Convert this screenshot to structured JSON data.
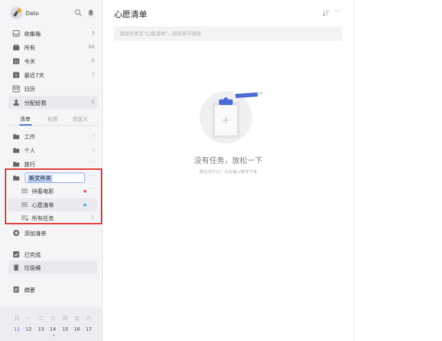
{
  "user": {
    "name": "Dato"
  },
  "nav": {
    "inbox": {
      "label": "收集箱",
      "count": "3"
    },
    "all": {
      "label": "所有",
      "count": "66"
    },
    "today": {
      "label": "今天",
      "count": "6",
      "icon_day": "11"
    },
    "next7": {
      "label": "最近7天",
      "count": "7",
      "icon_day": "5"
    },
    "calendar": {
      "label": "日历"
    },
    "assigned": {
      "label": "分配给我",
      "count": "5"
    }
  },
  "tabs": [
    "清单",
    "标签",
    "自定义"
  ],
  "folders": [
    {
      "label": "工作"
    },
    {
      "label": "个人"
    },
    {
      "label": "旅行"
    }
  ],
  "new_folder": {
    "value": "新文件夹",
    "more": "···"
  },
  "lists": [
    {
      "label": "待看电影",
      "dot_color": "#e8504a",
      "more": "···"
    },
    {
      "label": "心愿清单",
      "dot_color": "#3aa7e8"
    },
    {
      "label": "所有任务",
      "count": "1"
    }
  ],
  "add_list": {
    "label": "添加清单"
  },
  "completed": {
    "label": "已完成"
  },
  "trash": {
    "label": "垃圾桶"
  },
  "summary": {
    "label": "摘要"
  },
  "calendar_strip": {
    "weekdays": [
      "日",
      "一",
      "二",
      "三",
      "四",
      "五",
      "六"
    ],
    "days": [
      "11",
      "12",
      "13",
      "14",
      "15",
      "16",
      "17"
    ]
  },
  "main": {
    "title": "心愿清单",
    "add_placeholder": "添加任务至\"心愿清单\"，回车即可保存",
    "more": "···",
    "empty_title": "没有任务，放松一下",
    "empty_sub": "想记点什么？点击输入框写下来"
  },
  "colors": {
    "accent": "#4a6cd4",
    "highlight": "#e0322f"
  },
  "icons": [
    "search-icon",
    "bell-icon",
    "inbox-icon",
    "all-icon",
    "today-icon",
    "week-icon",
    "calendar-icon",
    "assigned-icon",
    "folder-icon",
    "list-icon",
    "plus-circle-icon",
    "check-icon",
    "trash-icon",
    "summary-icon",
    "sort-icon",
    "more-icon",
    "clipboard-illustration"
  ]
}
